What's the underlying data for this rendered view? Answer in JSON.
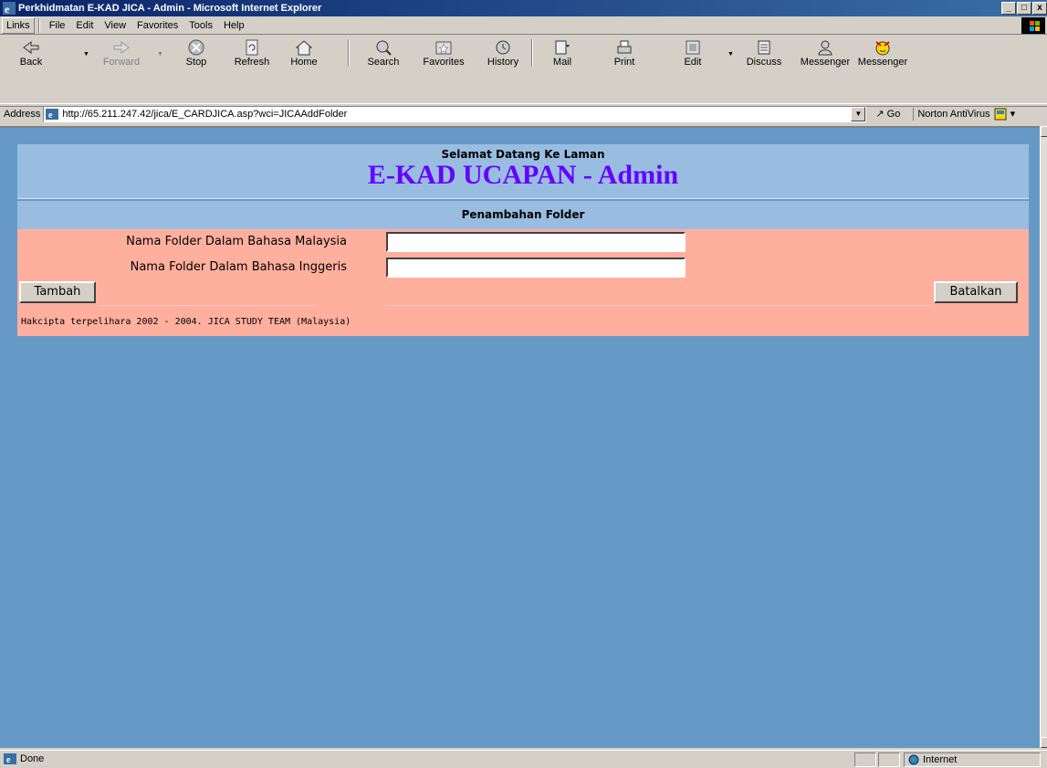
{
  "window": {
    "title": "Perkhidmatan E-KAD JICA - Admin - Microsoft Internet Explorer",
    "buttons": [
      "_",
      "□",
      "x"
    ]
  },
  "menubar": {
    "links_label": "Links",
    "items": [
      "File",
      "Edit",
      "View",
      "Favorites",
      "Tools",
      "Help"
    ]
  },
  "toolbar": {
    "buttons": [
      {
        "label": "Back",
        "icon": "back-arrow-icon"
      },
      {
        "label": "Forward",
        "icon": "forward-arrow-icon"
      },
      {
        "label": "Stop",
        "icon": "stop-icon"
      },
      {
        "label": "Refresh",
        "icon": "refresh-icon"
      },
      {
        "label": "Home",
        "icon": "home-icon"
      },
      {
        "label": "Search",
        "icon": "search-icon"
      },
      {
        "label": "Favorites",
        "icon": "favorites-icon"
      },
      {
        "label": "History",
        "icon": "history-icon"
      },
      {
        "label": "Mail",
        "icon": "mail-icon"
      },
      {
        "label": "Print",
        "icon": "print-icon"
      },
      {
        "label": "Edit",
        "icon": "edit-icon"
      },
      {
        "label": "Discuss",
        "icon": "discuss-icon"
      },
      {
        "label": "Messenger",
        "icon": "messenger-icon"
      },
      {
        "label": "Messenger",
        "icon": "messenger-smiley-icon"
      }
    ]
  },
  "addressbar": {
    "label": "Address",
    "url": "http://65.211.247.42/jica/E_CARDJICA.asp?wci=JICAAddFolder",
    "go_label": "Go",
    "norton_label": "Norton AntiVirus"
  },
  "page": {
    "welcome": "Selamat Datang Ke Laman",
    "title": "E-KAD UCAPAN - Admin",
    "subtitle": "Penambahan Folder",
    "fields": [
      {
        "label": "Nama Folder Dalam Bahasa Malaysia",
        "value": ""
      },
      {
        "label": "Nama Folder Dalam Bahasa Inggeris",
        "value": ""
      }
    ],
    "add_button": "Tambah",
    "cancel_button": "Batalkan",
    "copyright": "Hakcipta terpelihara 2002 - 2004. JICA STUDY TEAM (Malaysia)"
  },
  "statusbar": {
    "status": "Done",
    "zone": "Internet"
  },
  "colors": {
    "page_bg": "#6699c6",
    "header_bg": "#99bde0",
    "form_bg": "#ffaf9e",
    "title_color": "#6600ff"
  }
}
